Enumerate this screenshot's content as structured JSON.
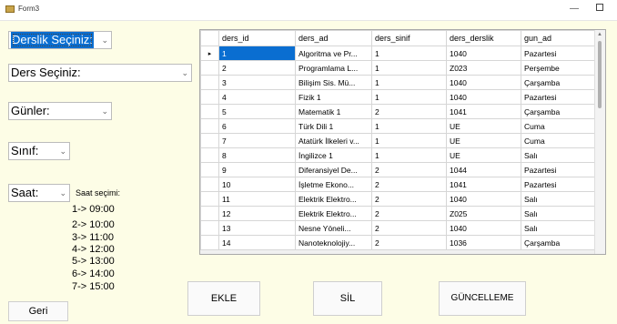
{
  "window": {
    "title": "Form3",
    "minimize_glyph": "—"
  },
  "combos": {
    "derslik": {
      "value": "Derslik Seçiniz:"
    },
    "ders": {
      "value": "Ders Seçiniz:"
    },
    "gunler": {
      "value": "Günler:"
    },
    "sinif": {
      "value": "Sınıf:"
    },
    "saat": {
      "value": "Saat:"
    },
    "arrow": "⌄"
  },
  "saat_secimi": {
    "label": "Saat seçimi:",
    "items": [
      "1-> 09:00",
      "2-> 10:00",
      "3-> 11:00",
      "4-> 12:00",
      "5-> 13:00",
      "6-> 14:00",
      "7-> 15:00"
    ]
  },
  "buttons": {
    "geri": "Geri",
    "ekle": "EKLE",
    "sil": "SİL",
    "guncelleme": "GÜNCELLEME"
  },
  "grid": {
    "current_row_marker": "▸",
    "columns": [
      "ders_id",
      "ders_ad",
      "ders_sinif",
      "ders_derslik",
      "gun_ad"
    ],
    "rows": [
      [
        "1",
        "Algoritma ve Pr...",
        "1",
        "1040",
        "Pazartesi"
      ],
      [
        "2",
        "Programlama L...",
        "1",
        "Z023",
        "Perşembe"
      ],
      [
        "3",
        "Bilişim Sis. Mü...",
        "1",
        "1040",
        "Çarşamba"
      ],
      [
        "4",
        "Fizik 1",
        "1",
        "1040",
        "Pazartesi"
      ],
      [
        "5",
        "Matematik 1",
        "2",
        "1041",
        "Çarşamba"
      ],
      [
        "6",
        "Türk Dili 1",
        "1",
        "UE",
        "Cuma"
      ],
      [
        "7",
        "Atatürk İlkeleri v...",
        "1",
        "UE",
        "Cuma"
      ],
      [
        "8",
        "İngilizce 1",
        "1",
        "UE",
        "Salı"
      ],
      [
        "9",
        "Diferansiyel De...",
        "2",
        "1044",
        "Pazartesi"
      ],
      [
        "10",
        "İşletme Ekono...",
        "2",
        "1041",
        "Pazartesi"
      ],
      [
        "11",
        "Elektrik Elektro...",
        "2",
        "1040",
        "Salı"
      ],
      [
        "12",
        "Elektrik Elektro...",
        "2",
        "Z025",
        "Salı"
      ],
      [
        "13",
        "Nesne Yöneli...",
        "2",
        "1040",
        "Salı"
      ],
      [
        "14",
        "Nanoteknolojiy...",
        "2",
        "1036",
        "Çarşamba"
      ]
    ]
  }
}
